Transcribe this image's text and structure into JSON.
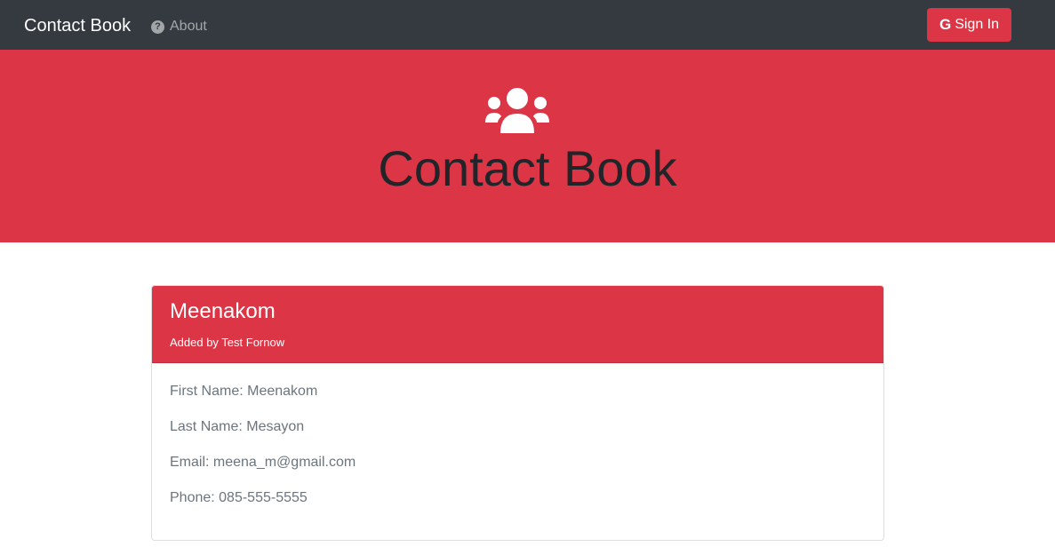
{
  "navbar": {
    "brand": "Contact Book",
    "about_label": "About",
    "signin_label": "Sign In"
  },
  "jumbotron": {
    "title": "Contact Book"
  },
  "contact": {
    "name": "Meenakom",
    "added_by": "Added by Test Fornow",
    "first_name": "First Name: Meenakom",
    "last_name": "Last Name: Mesayon",
    "email": "Email: meena_m@gmail.com",
    "phone": "Phone: 085-555-5555"
  },
  "colors": {
    "navbar_bg": "#343a40",
    "accent": "#dc3545",
    "muted_text": "#6c757d"
  },
  "icons": {
    "about": "question-circle-icon",
    "signin": "google-icon",
    "hero": "users-icon"
  }
}
